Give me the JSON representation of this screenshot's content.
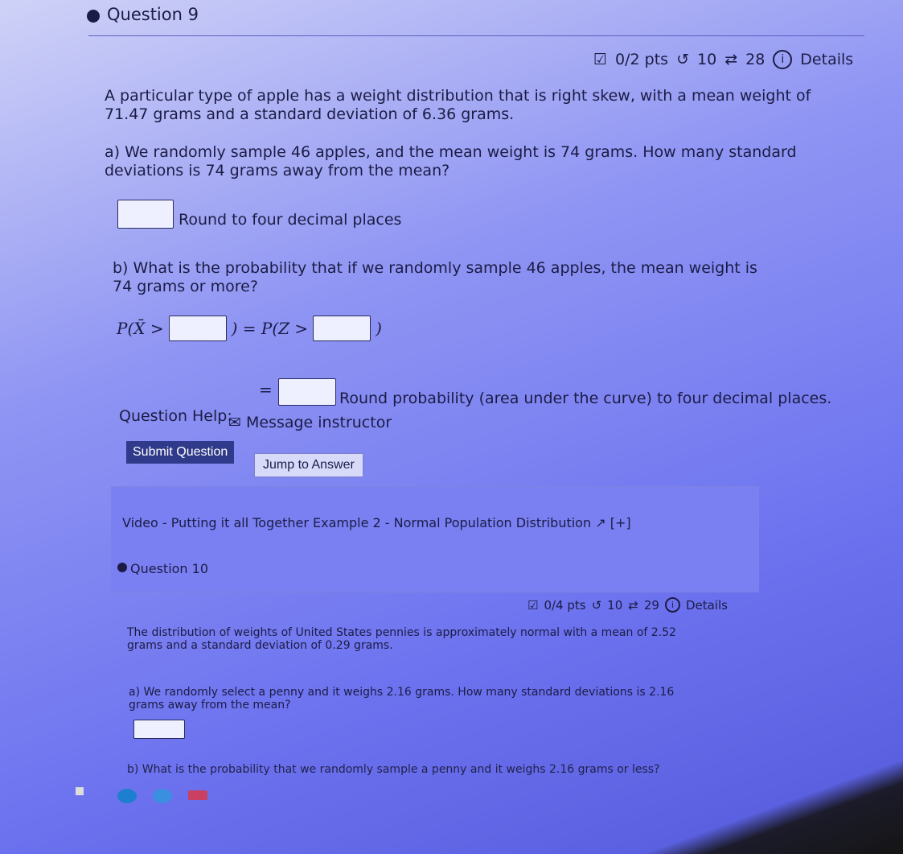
{
  "question9": {
    "title": "Question 9",
    "meta": {
      "points": "0/2 pts",
      "retries": "10",
      "attempts": "28",
      "details": "Details"
    },
    "intro": "A particular type of apple has a weight distribution that is right skew, with a mean weight of 71.47 grams and a standard deviation of 6.36 grams.",
    "part_a": "a) We randomly sample 46 apples, and the mean weight is 74 grams. How many standard deviations is 74 grams away from the mean?",
    "part_a_hint": "Round to four decimal places",
    "part_b": "b) What is the probability that if we randomly sample 46 apples, the mean weight is 74 grams or more?",
    "prob_left": "P(X̄ >",
    "prob_mid": ") = P(Z >",
    "prob_right": ")",
    "equals": "=",
    "part_b_hint": "Round probability (area under the curve) to four decimal places.",
    "help_label": "Question Help:",
    "message_instructor": "Message instructor",
    "submit": "Submit Question",
    "jump": "Jump to Answer"
  },
  "video": {
    "label": "Video - Putting it all Together Example 2 - Normal Population Distribution",
    "expand": "[+]"
  },
  "question10": {
    "title": "Question 10",
    "meta": {
      "points": "0/4 pts",
      "retries": "10",
      "attempts": "29",
      "details": "Details"
    },
    "intro": "The distribution of weights of United States pennies is approximately normal with a mean of 2.52 grams and a standard deviation of 0.29 grams.",
    "part_a": "a) We randomly select a penny and it weighs 2.16 grams. How many standard deviations is 2.16 grams away from the mean?",
    "part_b": "b) What is the probability that we randomly sample a penny and it weighs 2.16 grams or less?"
  }
}
